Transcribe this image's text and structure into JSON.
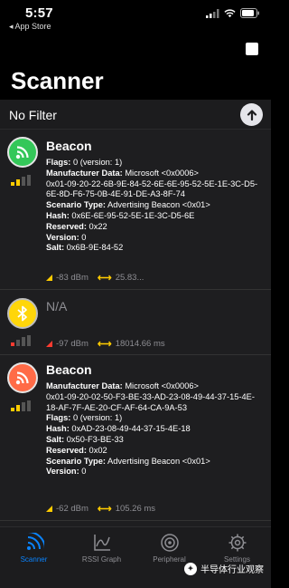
{
  "status": {
    "time": "5:57",
    "back_app": "◂ App Store"
  },
  "header": {
    "title": "Scanner"
  },
  "filter": {
    "label": "No Filter"
  },
  "devices": [
    {
      "name": "Beacon",
      "badge_color": "#34c759",
      "lines": [
        {
          "k": "Flags:",
          "v": " 0 (version: 1)"
        },
        {
          "k": "Manufacturer Data:",
          "v": " Microsoft <0x0006>"
        },
        {
          "k": "",
          "v": "0x01-09-20-22-6B-9E-84-52-6E-6E-95-52-5E-1E-3C-D5-6E-8D-F6-75-0B-4E-91-DE-A3-8F-74"
        },
        {
          "k": "Scenario Type:",
          "v": " Advertising Beacon <0x01>"
        },
        {
          "k": "Hash:",
          "v": " 0x6E-6E-95-52-5E-1E-3C-D5-6E"
        },
        {
          "k": "Reserved:",
          "v": " 0x22"
        },
        {
          "k": "Version:",
          "v": " 0"
        },
        {
          "k": "Salt:",
          "v": " 0x6B-9E-84-52"
        }
      ],
      "rssi": "-83 dBm",
      "interval": "25.83..."
    },
    {
      "name": "N/A",
      "badge_color": "#ffd60a",
      "rssi": "-97 dBm",
      "interval": "18014.66 ms"
    },
    {
      "name": "Beacon",
      "badge_color": "#ff6b47",
      "lines": [
        {
          "k": "Manufacturer Data:",
          "v": " Microsoft <0x0006>"
        },
        {
          "k": "",
          "v": "0x01-09-20-02-50-F3-BE-33-AD-23-08-49-44-37-15-4E-18-AF-7F-AE-20-CF-AF-64-CA-9A-53"
        },
        {
          "k": "Flags:",
          "v": " 0 (version: 1)"
        },
        {
          "k": "Hash:",
          "v": " 0xAD-23-08-49-44-37-15-4E-18"
        },
        {
          "k": "Salt:",
          "v": " 0x50-F3-BE-33"
        },
        {
          "k": "Reserved:",
          "v": " 0x02"
        },
        {
          "k": "Scenario Type:",
          "v": " Advertising Beacon <0x01>"
        },
        {
          "k": "Version:",
          "v": " 0"
        }
      ],
      "rssi": "-62 dBm",
      "interval": "105.26 ms"
    }
  ],
  "tabs": [
    {
      "label": "Scanner",
      "icon": "scanner-icon",
      "active": true
    },
    {
      "label": "RSSI Graph",
      "icon": "graph-icon",
      "active": false
    },
    {
      "label": "Peripheral",
      "icon": "peripheral-icon",
      "active": false
    },
    {
      "label": "Settings",
      "icon": "gear-icon",
      "active": false
    }
  ],
  "watermark": "半导体行业观察",
  "colors": {
    "accent": "#0a84ff",
    "signal": "#ffcc00",
    "weak": "#ff3b30"
  }
}
